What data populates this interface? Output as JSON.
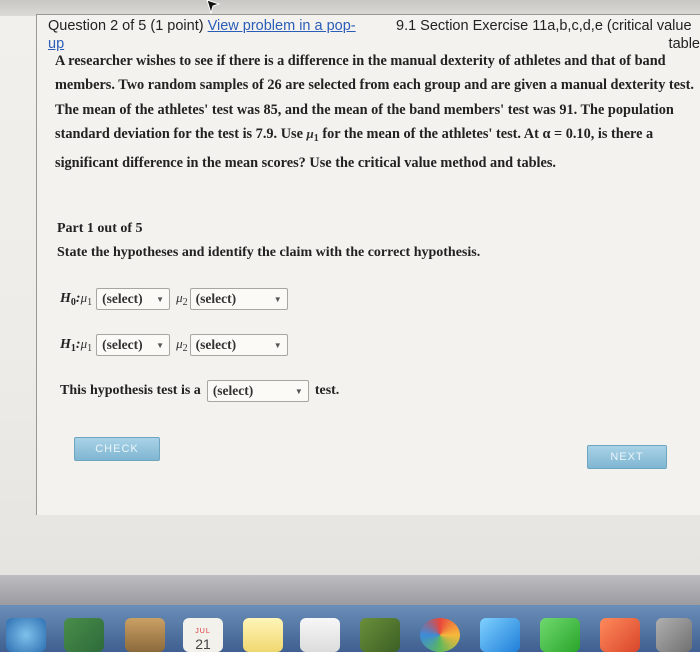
{
  "header": {
    "question_prefix": "Question 2 of 5 (1 point) ",
    "view_link_line1": "View problem in a pop-",
    "view_link_line2": "up",
    "section_line1": "9.1 Section Exercise 11a,b,c,d,e (critical value",
    "section_line2": "table"
  },
  "problem": {
    "text_a": "A researcher wishes to see if there is a difference in the manual dexterity of athletes and that of band members. Two random samples of 26 are selected from each group and are given a manual dexterity test. The mean of the athletes' test was 85, and the mean of the band members' test was 91. The population standard deviation for the test is 7.9. Use",
    "mu_symbol": "μ",
    "mu_sub": "1",
    "text_b": " for the mean of the athletes' test. At ",
    "alpha_text": "α = 0.10",
    "text_c": ", is there a significant difference in the mean scores? Use the critical value method and tables."
  },
  "part": {
    "label": "Part 1 out of 5",
    "instruction": "State the hypotheses and identify the claim with the correct hypothesis."
  },
  "h0": {
    "H": "H",
    "sub": "0",
    "colon": " : ",
    "mu1": "μ",
    "mu1_sub": "1",
    "select1": "(select)",
    "mu2": "μ",
    "mu2_sub": "2",
    "select2": "(select)"
  },
  "h1": {
    "H": "H",
    "sub": "1",
    "colon": " : ",
    "mu1": "μ",
    "mu1_sub": "1",
    "select1": "(select)",
    "mu2": "μ",
    "mu2_sub": "2",
    "select2": "(select)"
  },
  "test_sentence": {
    "prefix": "This hypothesis test is a",
    "select": "(select)",
    "suffix": "test."
  },
  "buttons": {
    "check": "CHECK",
    "next": "NEXT"
  },
  "dock": {
    "calendar_month": "JUL",
    "calendar_day": "21"
  },
  "colors": {
    "link": "#2a5db8",
    "button": "#8cc0da",
    "dock": "#5577a3"
  }
}
